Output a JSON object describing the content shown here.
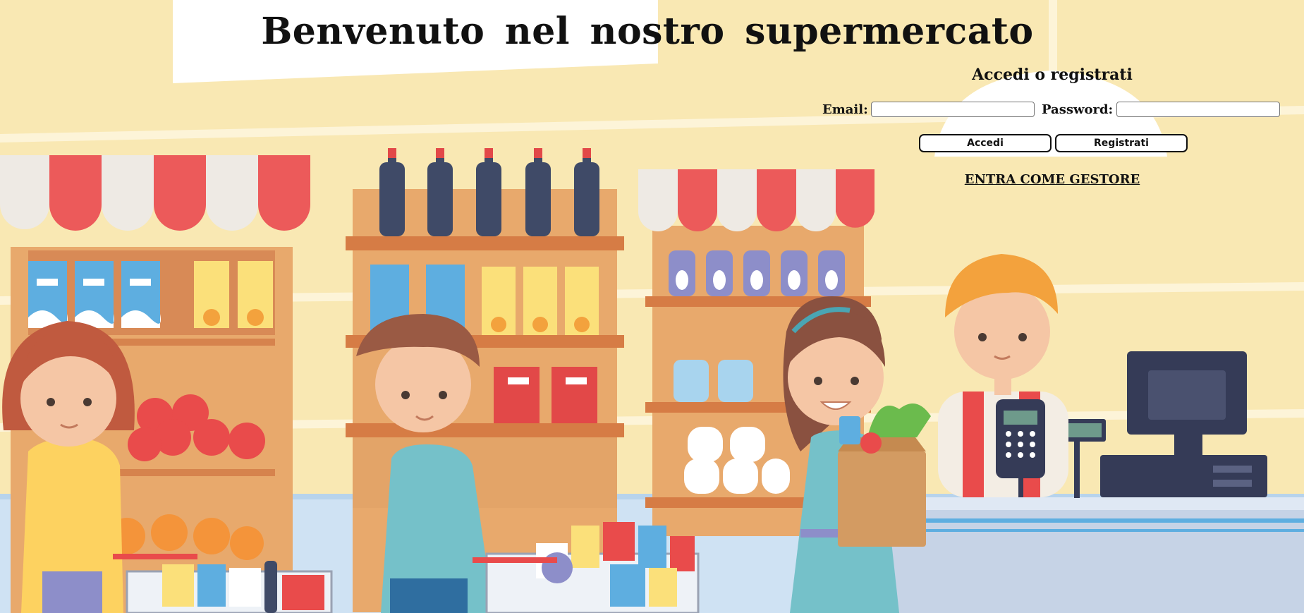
{
  "page": {
    "title": "Benvenuto nel nostro supermercato"
  },
  "login": {
    "heading": "Accedi o registrati",
    "email_label": "Email:",
    "email_value": "",
    "password_label": "Password:",
    "password_value": "",
    "login_button": "Accedi",
    "register_button": "Registrati",
    "manager_link": "ENTRA COME GESTORE"
  },
  "colors": {
    "background": "#f9e8b3",
    "awning_red": "#ec5a5a",
    "awning_white": "#eeeae4",
    "shelf_wood": "#e0a062",
    "floor_blue": "#cfe2f3"
  }
}
